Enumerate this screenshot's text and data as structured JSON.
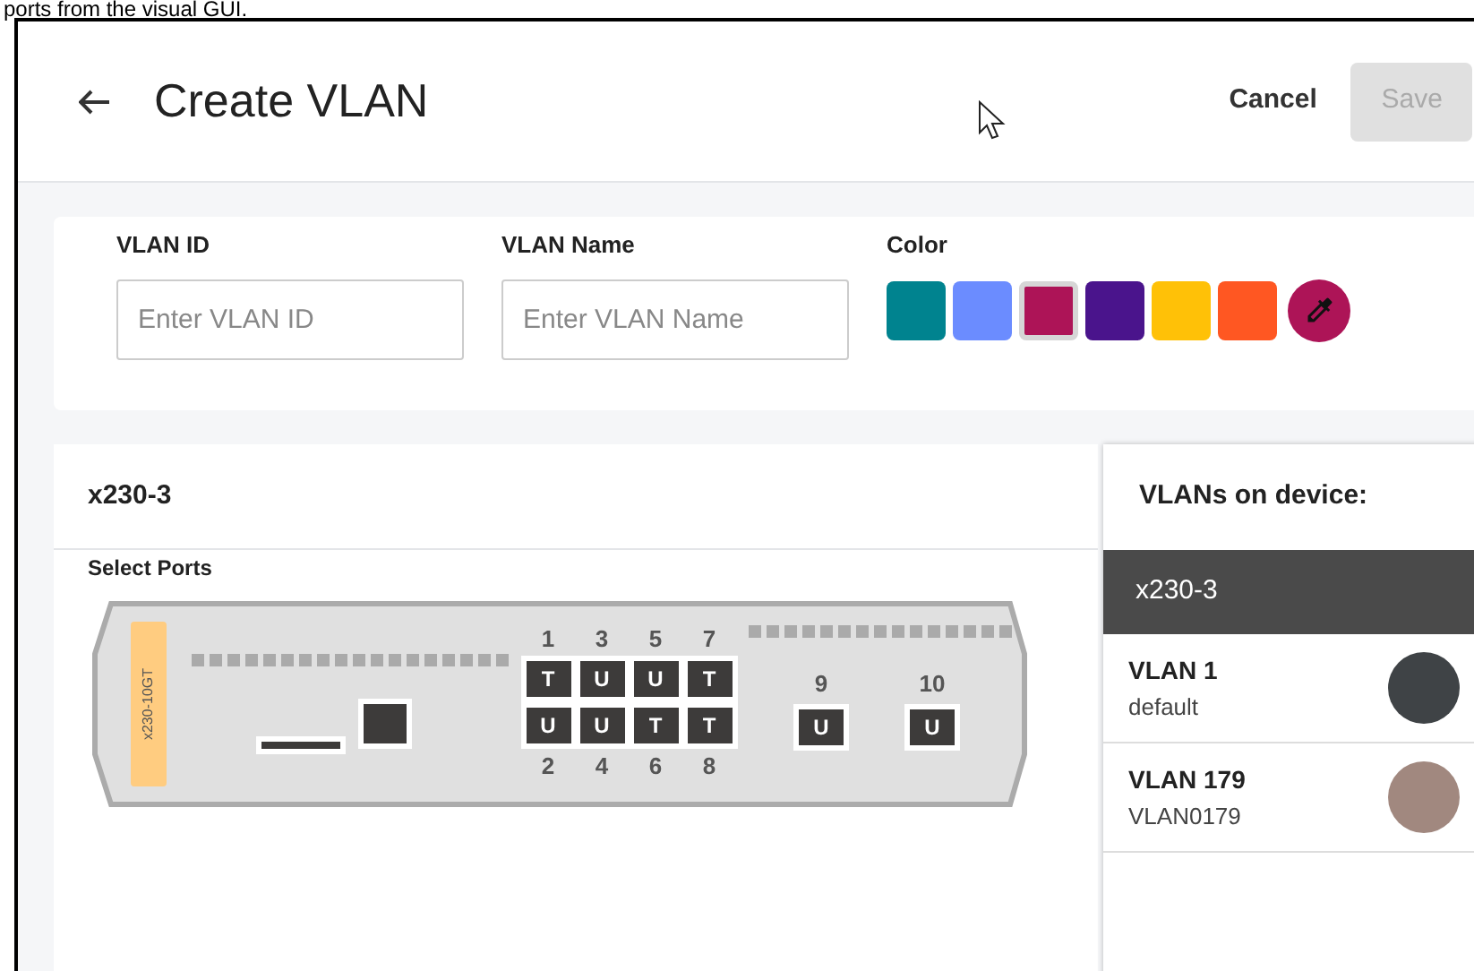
{
  "caption": "ports from the visual GUI.",
  "header": {
    "title": "Create VLAN",
    "cancel": "Cancel",
    "save": {
      "label": "Save",
      "disabled": true
    }
  },
  "form": {
    "fields": [
      {
        "label": "VLAN ID",
        "placeholder": "Enter VLAN ID"
      },
      {
        "label": "VLAN Name",
        "placeholder": "Enter VLAN Name"
      }
    ],
    "color_label": "Color",
    "swatches": [
      {
        "color": "#00838f",
        "selected": false
      },
      {
        "color": "#6b8cff",
        "selected": false
      },
      {
        "color": "#ad1457",
        "selected": true
      },
      {
        "color": "#4a148c",
        "selected": false
      },
      {
        "color": "#ffc107",
        "selected": false
      },
      {
        "color": "#ff5722",
        "selected": false
      }
    ],
    "picker": {
      "color": "#ad1457"
    }
  },
  "device": {
    "title": "x230-3",
    "select_label": "Select Ports",
    "model": "x230-10GT",
    "ports": [
      {
        "number": "1",
        "mode": "T",
        "kind": "copper"
      },
      {
        "number": "2",
        "mode": "U",
        "kind": "copper"
      },
      {
        "number": "3",
        "mode": "U",
        "kind": "copper"
      },
      {
        "number": "4",
        "mode": "U",
        "kind": "copper"
      },
      {
        "number": "5",
        "mode": "U",
        "kind": "copper"
      },
      {
        "number": "6",
        "mode": "T",
        "kind": "copper"
      },
      {
        "number": "7",
        "mode": "T",
        "kind": "copper"
      },
      {
        "number": "8",
        "mode": "T",
        "kind": "copper"
      },
      {
        "number": "9",
        "mode": "U",
        "kind": "sfp"
      },
      {
        "number": "10",
        "mode": "U",
        "kind": "sfp"
      }
    ]
  },
  "vlans": {
    "title": "VLANs on device:",
    "device": "x230-3",
    "items": [
      {
        "name": "VLAN 1",
        "description": "default",
        "color": "#3f4346"
      },
      {
        "name": "VLAN 179",
        "description": "VLAN0179",
        "color": "#a1887f"
      }
    ]
  }
}
